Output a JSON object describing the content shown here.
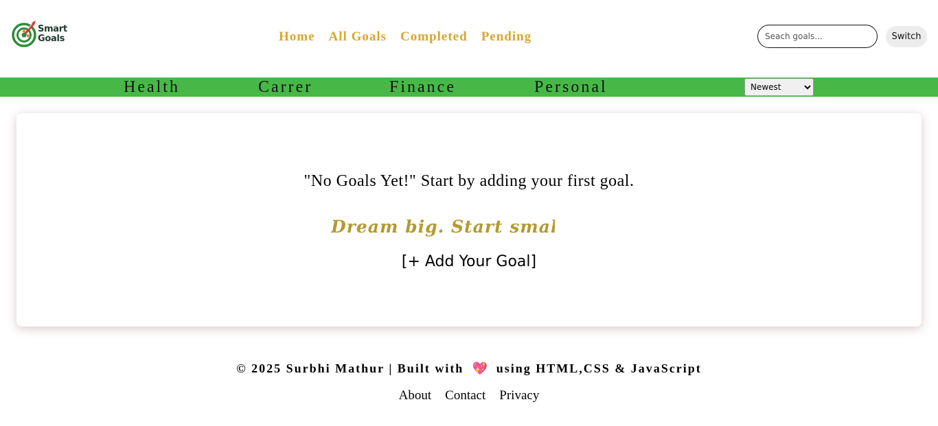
{
  "header": {
    "logo": {
      "line1": "Smart",
      "line2": "Goals",
      "icon": "rocket-target-icon"
    },
    "nav": [
      "Home",
      "All Goals",
      "Completed",
      "Pending"
    ],
    "search": {
      "placeholder": "Seach goals...",
      "value": ""
    },
    "switch_label": "Switch"
  },
  "categories": [
    "Health",
    "Carrer",
    "Finance",
    "Personal"
  ],
  "sort": {
    "selected": "Newest"
  },
  "main": {
    "empty_message": "\"No Goals Yet!\" Start by adding your first goal.",
    "tagline": "Dream big. Start small. Ac",
    "add_goal_label": "[+ Add Your Goal]"
  },
  "footer": {
    "copyright_left": "© 2025 Surbhi Mathur | Built with",
    "copyright_heart": "💖",
    "copyright_right": "using HTML,CSS & JavaScript",
    "links": [
      "About",
      "Contact",
      "Privacy"
    ]
  },
  "colors": {
    "nav_text": "#d9a62e",
    "category_bar": "#47b847",
    "tagline": "#b39b2f",
    "logo_green": "#2e8b3a",
    "logo_red": "#d9332b"
  }
}
